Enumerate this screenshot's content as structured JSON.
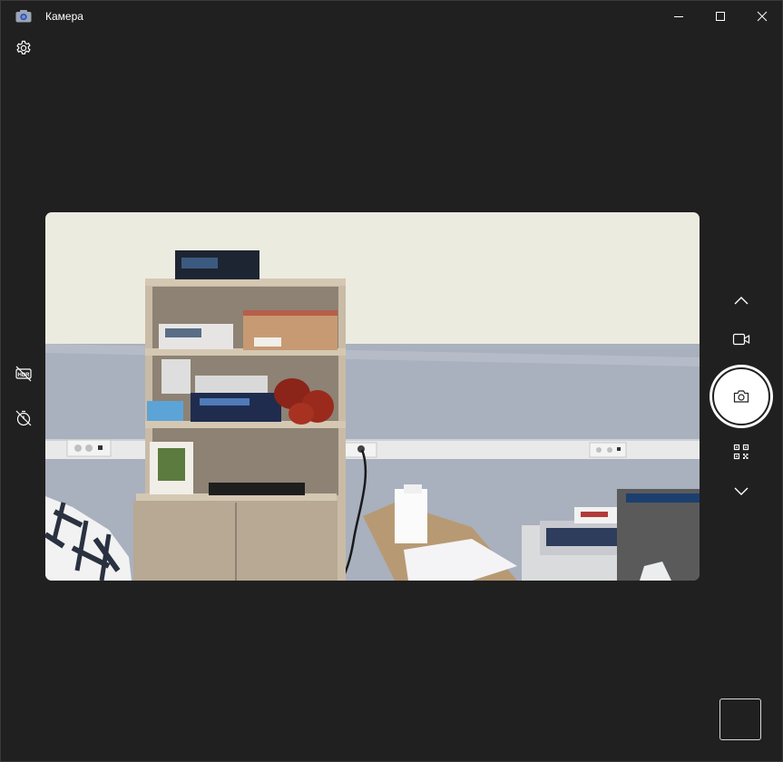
{
  "window": {
    "title": "Камера",
    "app_icon": "camera-app-icon",
    "controls": [
      "minimize-icon",
      "maximize-icon",
      "close-icon"
    ]
  },
  "toolbar": {
    "settings_icon": "gear-icon"
  },
  "left_controls": [
    "hdr-off-icon",
    "timer-off-icon"
  ],
  "right_controls": {
    "items": [
      "chevron-up-icon",
      "video-mode-icon",
      "photo-shutter",
      "qr-code-icon",
      "chevron-down-icon"
    ],
    "shutter_icon": "camera-icon"
  },
  "colors": {
    "background": "#202020",
    "foreground": "#ffffff",
    "shutter": "#ffffff"
  },
  "preview": {
    "description_icon": "live-camera-preview"
  }
}
